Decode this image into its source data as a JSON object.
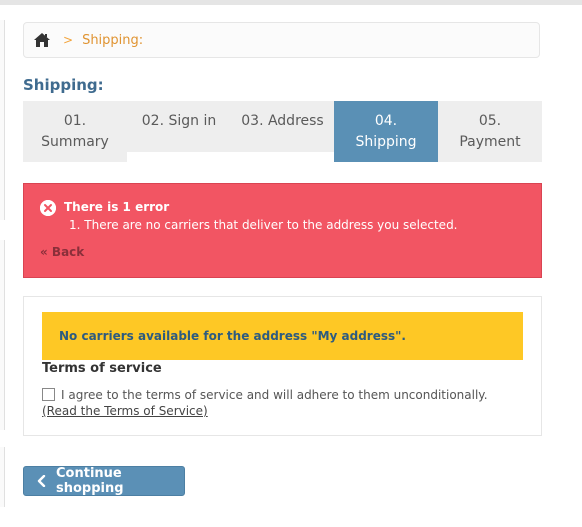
{
  "breadcrumb": {
    "home_icon": "home-icon",
    "separator": ">",
    "current": "Shipping:"
  },
  "page": {
    "title": "Shipping:"
  },
  "steps": [
    {
      "number": "01.",
      "label": "Summary",
      "active": false
    },
    {
      "number": "02.",
      "label": "Sign in",
      "active": false
    },
    {
      "number": "03.",
      "label": "Address",
      "active": false
    },
    {
      "number": "04.",
      "label": "Shipping",
      "active": true
    },
    {
      "number": "05.",
      "label": "Payment",
      "active": false
    }
  ],
  "error": {
    "icon": "close-circle-icon",
    "title": "There is 1 error",
    "message": "1.  There are no carriers that deliver to the address you selected.",
    "back_label": "« Back"
  },
  "warning": {
    "text": "No carriers available for the address \"My address\"."
  },
  "terms": {
    "title": "Terms of service",
    "agree_text": "I agree to the terms of service and will adhere to them unconditionally.",
    "link_text": "(Read the Terms of Service)",
    "checked": false
  },
  "actions": {
    "continue_label": "Continue shopping",
    "continue_icon": "chevron-left-icon"
  },
  "colors": {
    "accent": "#5a90b5",
    "error_bg": "#f25563",
    "warning_bg": "#fec825",
    "breadcrumb_link": "#e09432",
    "title": "#3f6b8f"
  }
}
